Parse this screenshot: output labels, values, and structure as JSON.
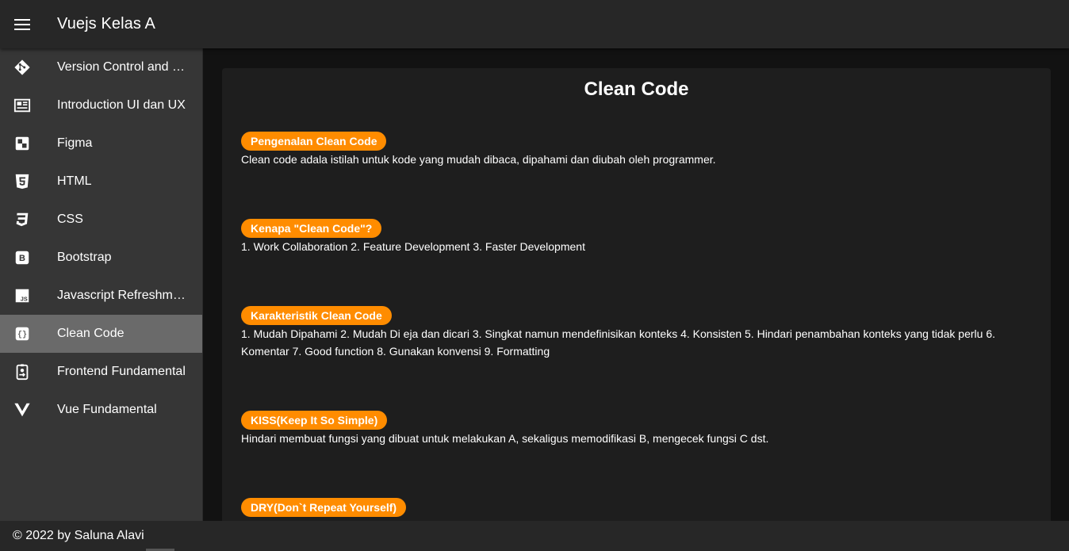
{
  "app": {
    "title": "Vuejs Kelas A"
  },
  "sidebar": {
    "items": [
      {
        "label": "Version Control and Branch Management",
        "icon": "git-icon"
      },
      {
        "label": "Introduction UI dan UX",
        "icon": "newspaper-icon"
      },
      {
        "label": "Figma",
        "icon": "figma-icon"
      },
      {
        "label": "HTML",
        "icon": "html5-icon"
      },
      {
        "label": "CSS",
        "icon": "css3-icon"
      },
      {
        "label": "Bootstrap",
        "icon": "bootstrap-icon"
      },
      {
        "label": "Javascript Refreshment",
        "icon": "javascript-icon"
      },
      {
        "label": "Clean Code",
        "icon": "code-braces-icon",
        "active": true
      },
      {
        "label": "Frontend Fundamental",
        "icon": "badge-account-icon"
      },
      {
        "label": "Vue Fundamental",
        "icon": "vuejs-icon"
      }
    ]
  },
  "main": {
    "title": "Clean Code",
    "sections": [
      {
        "chip": "Pengenalan Clean Code",
        "text": "Clean code adala istilah untuk kode yang mudah dibaca, dipahami dan diubah oleh programmer."
      },
      {
        "chip": "Kenapa \"Clean Code\"?",
        "text": "1. Work Collaboration 2. Feature Development 3. Faster Development"
      },
      {
        "chip": "Karakteristik Clean Code",
        "text": "1. Mudah Dipahami 2. Mudah Di eja dan dicari 3. Singkat namun mendefinisikan konteks 4. Konsisten 5. Hindari penambahan konteks yang tidak perlu 6. Komentar 7. Good function 8. Gunakan konvensi 9. Formatting"
      },
      {
        "chip": "KISS(Keep It So Simple)",
        "text": "Hindari membuat fungsi yang dibuat untuk melakukan A, sekaligus memodifikasi B, mengecek fungsi C dst."
      },
      {
        "chip": "DRY(Don`t Repeat Yourself)",
        "text": ""
      }
    ]
  },
  "footer": {
    "text": "© 2022 by Saluna Alavi"
  },
  "colors": {
    "accent": "#ff8c00",
    "active_nav": "#6a6a6a",
    "sidebar": "#363636",
    "appbar": "#272727"
  }
}
